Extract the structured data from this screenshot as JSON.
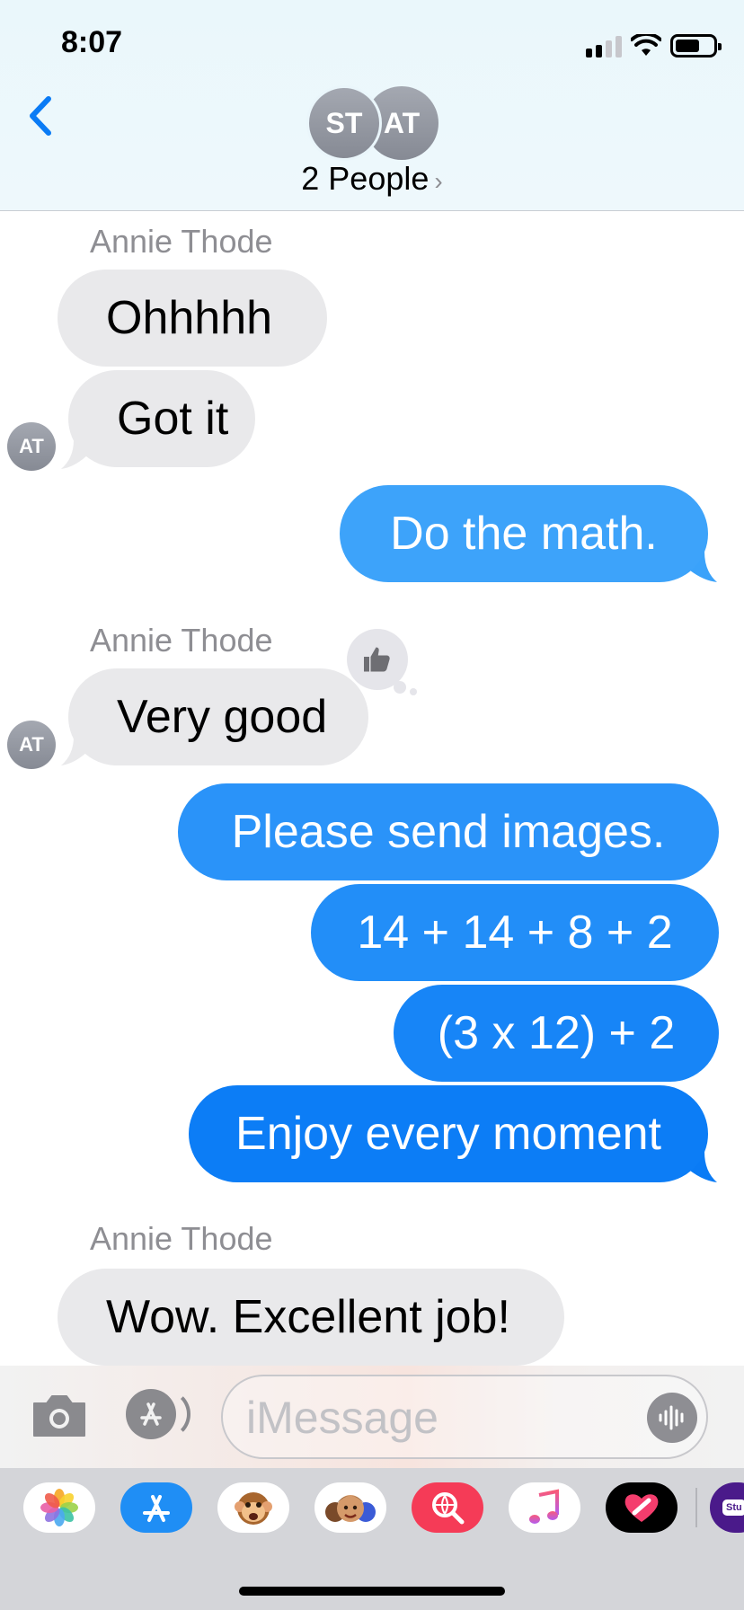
{
  "status_bar": {
    "time": "8:07"
  },
  "header": {
    "avatars": [
      "ST",
      "AT"
    ],
    "title": "2 People",
    "title_chevron": "›"
  },
  "messages": {
    "name_1": "Annie Thode",
    "m1": "Ohhhhh",
    "m2": "Got it",
    "avatar_1": "AT",
    "m3": "Do the math.",
    "name_2": "Annie Thode",
    "m4": "Very good",
    "avatar_2": "AT",
    "m5": "Please send images.",
    "m6": "14 + 14 + 8 + 2",
    "m7": "(3 x 12) + 2",
    "m8": "Enjoy every moment",
    "name_3": "Annie Thode",
    "m9": "Wow. Excellent job!"
  },
  "input": {
    "placeholder": "iMessage"
  },
  "app_drawer": {
    "apps": [
      "photos-icon",
      "app-store-icon",
      "animoji-icon",
      "memoji-icon",
      "search-images-icon",
      "music-icon",
      "digital-touch-icon",
      "stickers-icon"
    ],
    "partial_label": "Stu"
  },
  "colors": {
    "incoming": "#e9e9eb",
    "outgoing_top": "#42a5fa",
    "outgoing_bottom": "#0a7bf5",
    "accent": "#007aff"
  }
}
